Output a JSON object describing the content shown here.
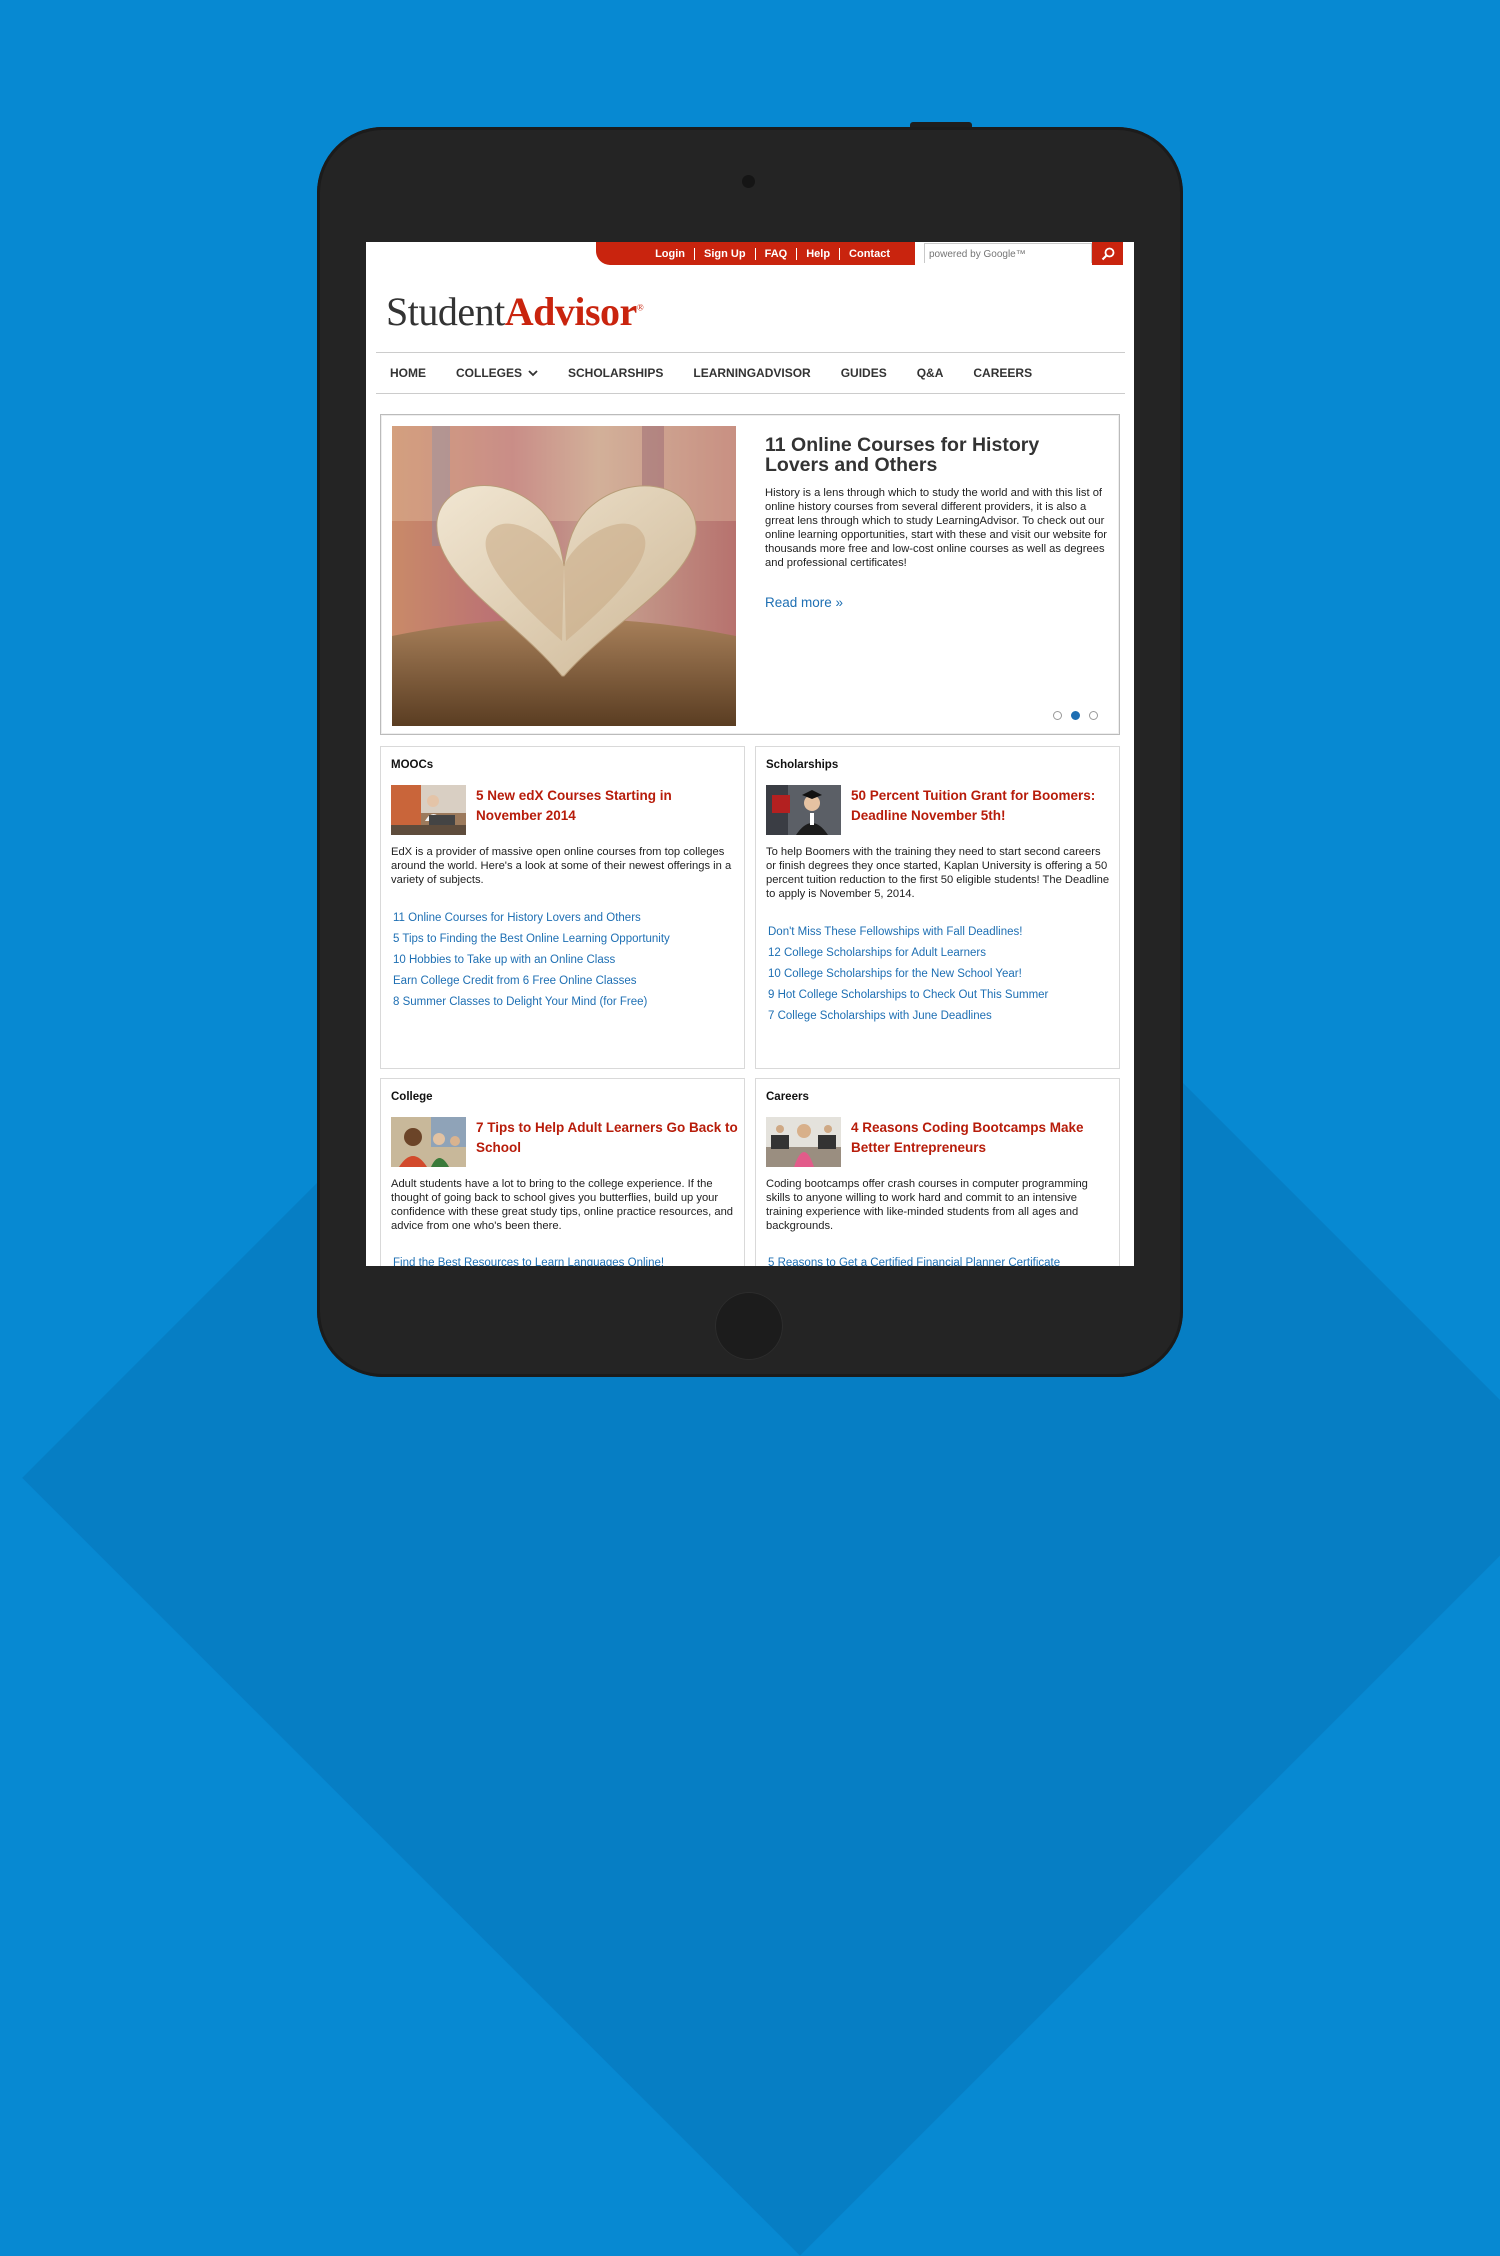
{
  "topbar": {
    "links": [
      "Login",
      "Sign Up",
      "FAQ",
      "Help",
      "Contact"
    ],
    "search_placeholder": "powered by Google™"
  },
  "logo": {
    "part1": "Student",
    "part2": "Advisor",
    "mark": "®"
  },
  "nav": [
    "HOME",
    "COLLEGES",
    "SCHOLARSHIPS",
    "LEARNINGADVISOR",
    "GUIDES",
    "Q&A",
    "CAREERS"
  ],
  "hero": {
    "title": "11 Online Courses for History Lovers and Others",
    "body": "History is a lens through which to study the world and with this list of online history courses from several different providers, it is also a grreat lens through which to study LearningAdvisor. To check out our online learning opportunities, start with these and visit our website for thousands more free and low-cost online courses as well as degrees and professional certificates!",
    "read_more": "Read more »",
    "active_slide": 2,
    "slide_count": 3
  },
  "cards": [
    {
      "category": "MOOCs",
      "title": "5 New edX Courses Starting in November 2014",
      "body": "EdX is a provider of massive open online courses from top colleges around the world. Here's a look at some of their newest offerings in a variety of subjects.",
      "links": [
        "11 Online Courses for History Lovers and Others",
        "5 Tips to Finding the Best Online Learning Opportunity",
        "10 Hobbies to Take up with an Online Class",
        "Earn College Credit from 6 Free Online Classes",
        "8 Summer Classes to Delight Your Mind (for Free)"
      ]
    },
    {
      "category": "Scholarships",
      "title": "50 Percent Tuition Grant for Boomers: Deadline November 5th!",
      "body": "To help Boomers with the training they need to start second careers or finish degrees they once started, Kaplan University is offering a 50 percent tuition reduction to the first 50 eligible students! The Deadline to apply is November 5, 2014.",
      "links": [
        "Don't Miss These Fellowships with Fall Deadlines!",
        "12 College Scholarships for Adult Learners",
        "10 College Scholarships for the New School Year!",
        "9 Hot College Scholarships to Check Out This Summer",
        "7 College Scholarships with June Deadlines"
      ]
    },
    {
      "category": "College",
      "title": "7 Tips to Help Adult Learners Go Back to School",
      "body": "Adult students have a lot to bring to the college experience. If the thought of going back to school gives you butterflies, build up your confidence with these great study tips, online practice resources, and advice from one who's been there.",
      "links": [
        "Find the Best Resources to Learn Languages Online!"
      ]
    },
    {
      "category": "Careers",
      "title": "4 Reasons Coding Bootcamps Make Better Entrepreneurs",
      "body": "Coding bootcamps offer crash courses in computer programming skills to anyone willing to work hard and commit to an intensive training experience with like-minded students from all ages and backgrounds.",
      "links": [
        "5 Reasons to Get a Certified Financial Planner Certificate"
      ]
    }
  ]
}
